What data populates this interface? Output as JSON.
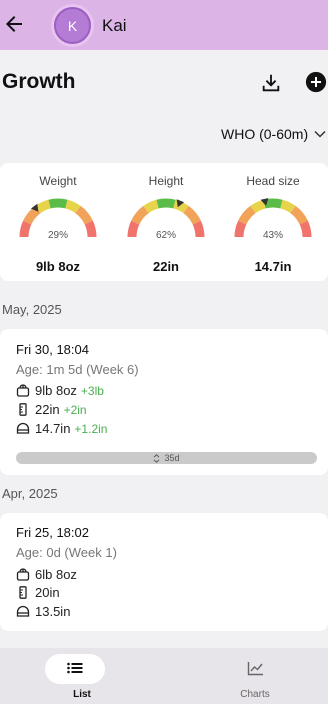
{
  "header": {
    "avatar_initial": "K",
    "name": "Kai"
  },
  "page": {
    "title": "Growth",
    "standard_selector": "WHO (0-60m)"
  },
  "summary": [
    {
      "label": "Weight",
      "percentile_label": "29%",
      "percentile": 0.29,
      "value": "9lb 8oz"
    },
    {
      "label": "Height",
      "percentile_label": "62%",
      "percentile": 0.62,
      "value": "22in"
    },
    {
      "label": "Head size",
      "percentile_label": "43%",
      "percentile": 0.43,
      "value": "14.7in"
    }
  ],
  "sections": [
    {
      "month": "May, 2025",
      "entries": [
        {
          "datetime": "Fri 30, 18:04",
          "age": "Age: 1m 5d (Week 6)",
          "weight": "9lb 8oz",
          "weight_delta": "+3lb",
          "height": "22in",
          "height_delta": "+2in",
          "head": "14.7in",
          "head_delta": "+1.2in"
        }
      ],
      "gap_label": "35d"
    },
    {
      "month": "Apr, 2025",
      "entries": [
        {
          "datetime": "Fri 25, 18:02",
          "age": "Age: 0d (Week 1)",
          "weight": "6lb 8oz",
          "height": "20in",
          "head": "13.5in"
        }
      ]
    }
  ],
  "nav": {
    "list_label": "List",
    "charts_label": "Charts"
  },
  "colors": {
    "appbar": "#dcb4e6",
    "avatar": "#b57cd6",
    "delta_green": "#4caf50",
    "background": "#f1f0f3"
  }
}
